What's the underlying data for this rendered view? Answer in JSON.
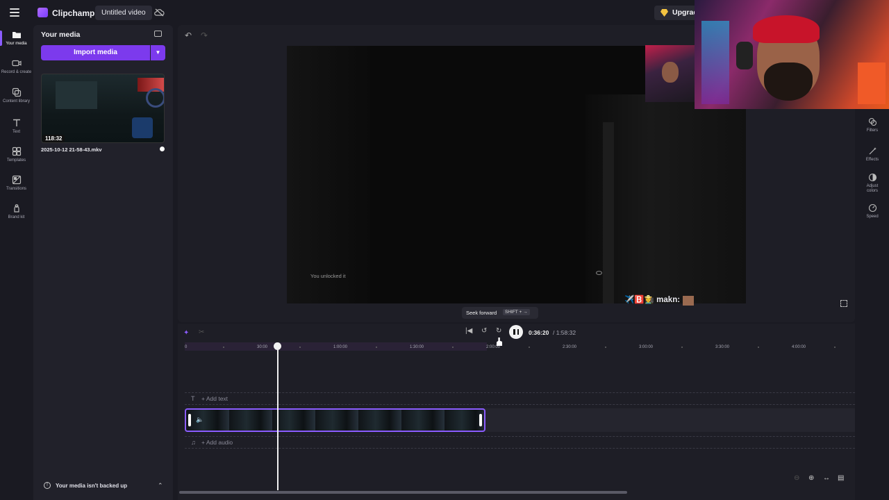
{
  "topbar": {
    "app_name": "Clipchamp",
    "project_title": "Untitled video",
    "upgrade_label": "Upgrad"
  },
  "rail": {
    "items": [
      {
        "label": "Your media",
        "icon": "folder-icon",
        "active": true
      },
      {
        "label": "Record & create",
        "icon": "camera-icon",
        "active": false
      },
      {
        "label": "Content library",
        "icon": "library-icon",
        "active": false
      },
      {
        "label": "Text",
        "icon": "text-icon",
        "active": false
      },
      {
        "label": "Templates",
        "icon": "templates-icon",
        "active": false
      },
      {
        "label": "Transitions",
        "icon": "transitions-icon",
        "active": false
      },
      {
        "label": "Brand kit",
        "icon": "brand-kit-icon",
        "active": false
      }
    ]
  },
  "media_panel": {
    "title": "Your media",
    "import_label": "Import media",
    "file": {
      "duration": "118:32",
      "name": "2025-10-12 21-58-43.mkv"
    },
    "backup_text": "Your media isn't backed up"
  },
  "preview": {
    "caption": "You unlocked it",
    "chat_name": "makn:",
    "chat_prefix": "✈️🅱️👩‍🌾"
  },
  "properties": [
    {
      "label": "Filters",
      "icon": "filters-icon"
    },
    {
      "label": "Effects",
      "icon": "effects-icon"
    },
    {
      "label": "Adjust colors",
      "icon": "adjust-colors-icon"
    },
    {
      "label": "Speed",
      "icon": "speed-icon"
    }
  ],
  "tooltip": {
    "label": "Seek forward",
    "shortcut": "SHIFT + →"
  },
  "playback": {
    "current": "0:36:20",
    "total": "/ 1:58:32"
  },
  "ruler": {
    "ticks": [
      "0",
      "30:00",
      "1:00:00",
      "1:30:00",
      "2:00:00",
      "2:30:00",
      "3:00:00",
      "3:30:00",
      "4:00:00"
    ]
  },
  "tracks": {
    "add_text": "+ Add text",
    "add_audio": "+ Add audio"
  },
  "colors": {
    "accent": "#7c3aed",
    "accent_light": "#8b5cff",
    "bg": "#1a1a22"
  }
}
